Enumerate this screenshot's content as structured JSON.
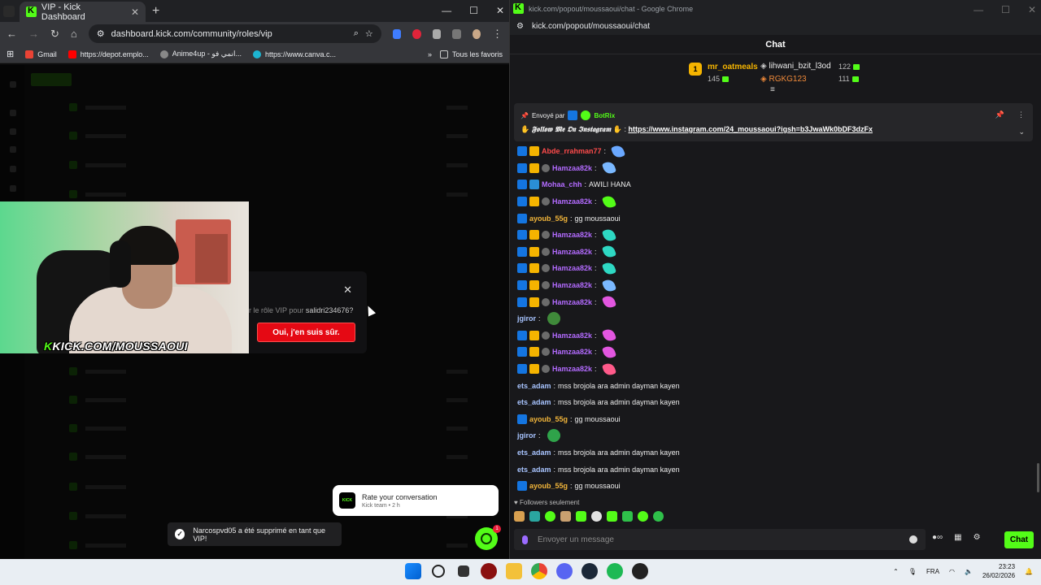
{
  "left_browser": {
    "tab_title": "VIP - Kick Dashboard",
    "url": "dashboard.kick.com/community/roles/vip",
    "bookmarks": [
      "Gmail",
      "https://depot.emplo...",
      "Anime4up - انمي فو...",
      "https://www.canva.c..."
    ],
    "bookmarks_right": "Tous les favoris"
  },
  "webcam": {
    "banner_prefix": "K",
    "banner_text": "KICK.COM/MOUSSAOUI"
  },
  "modal": {
    "prompt": "r le rôle VIP pour ",
    "username": "salidri234676?",
    "confirm_label": "Oui, j'en suis sûr."
  },
  "rate_popup": {
    "title": "Rate your conversation",
    "subtitle": "Kick team • 2 h",
    "logo": "KICK"
  },
  "toast": {
    "text": "Narcospvd05 a été supprimé en tant que VIP!"
  },
  "support": {
    "badge_count": "1"
  },
  "right_browser": {
    "window_title": "kick.com/popout/moussaoui/chat - Google Chrome",
    "url": "kick.com/popout/moussaoui/chat"
  },
  "chat": {
    "header": "Chat",
    "leaderboard": {
      "first": {
        "rank": "1",
        "name": "mr_oatmeals",
        "count": "145"
      },
      "second": {
        "name": "lihwani_bzit_l3od",
        "count": "122"
      },
      "third": {
        "name": "RGKG123",
        "count": "111"
      }
    },
    "pinned": {
      "sent_by": "Envoyé par",
      "author": "BotRix",
      "message_fancy": "𝕱𝖔𝖑𝖑𝖔𝖜 𝕸𝖊 𝕺𝖓 𝕴𝖓𝖘𝖙𝖆𝖌𝖗𝖆𝖒",
      "link": "https://www.instagram.com/24_moussaoui?igsh=b3JwaWk0bDF3dzFx"
    },
    "messages": [
      {
        "user": "Abde_rrahman77",
        "text": "",
        "color": "#ff4b4b",
        "badges": [
          "mod",
          "vip"
        ],
        "emote": "#6aa8ff"
      },
      {
        "user": "Hamzaa82k",
        "text": "",
        "color": "#b36bff",
        "badges": [
          "mod",
          "vip",
          "sub"
        ],
        "emote": "#7ab8ff"
      },
      {
        "user": "Mohaa_chh",
        "text": " AWILI HANA",
        "color": "#b36bff",
        "badges": [
          "mod",
          "vip2"
        ],
        "emote": ""
      },
      {
        "user": "Hamzaa82k",
        "text": "",
        "color": "#b36bff",
        "badges": [
          "mod",
          "vip",
          "sub"
        ],
        "emote": "#53fc18"
      },
      {
        "user": "ayoub_55g",
        "text": " gg moussaoui",
        "color": "#f0b43a",
        "badges": [
          "mod"
        ],
        "emote": ""
      },
      {
        "user": "Hamzaa82k",
        "text": "",
        "color": "#b36bff",
        "badges": [
          "mod",
          "vip",
          "sub"
        ],
        "emote": "#2ed8c3"
      },
      {
        "user": "Hamzaa82k",
        "text": "",
        "color": "#b36bff",
        "badges": [
          "mod",
          "vip",
          "sub"
        ],
        "emote": "#2ed8c3"
      },
      {
        "user": "Hamzaa82k",
        "text": "",
        "color": "#b36bff",
        "badges": [
          "mod",
          "vip",
          "sub"
        ],
        "emote": "#2ed8c3"
      },
      {
        "user": "Hamzaa82k",
        "text": "",
        "color": "#b36bff",
        "badges": [
          "mod",
          "vip",
          "sub"
        ],
        "emote": "#7ab8ff"
      },
      {
        "user": "Hamzaa82k",
        "text": "",
        "color": "#b36bff",
        "badges": [
          "mod",
          "vip",
          "sub"
        ],
        "emote": "#e256e0"
      },
      {
        "user": "jgiror",
        "text": "",
        "color": "#a8c4ff",
        "badges": [],
        "emote": "#3f8a3a"
      },
      {
        "user": "Hamzaa82k",
        "text": "",
        "color": "#b36bff",
        "badges": [
          "mod",
          "vip",
          "sub"
        ],
        "emote": "#e256e0"
      },
      {
        "user": "Hamzaa82k",
        "text": "",
        "color": "#b36bff",
        "badges": [
          "mod",
          "vip",
          "sub"
        ],
        "emote": "#e256e0"
      },
      {
        "user": "Hamzaa82k",
        "text": "",
        "color": "#b36bff",
        "badges": [
          "mod",
          "vip",
          "sub"
        ],
        "emote": "#ff5a8a"
      },
      {
        "user": "ets_adam",
        "text": " mss brojola ara admin dayman kayen",
        "color": "#a8c4ff",
        "badges": [],
        "emote": ""
      },
      {
        "user": "ets_adam",
        "text": " mss brojola ara admin dayman kayen",
        "color": "#a8c4ff",
        "badges": [],
        "emote": ""
      },
      {
        "user": "ayoub_55g",
        "text": " gg moussaoui",
        "color": "#f0b43a",
        "badges": [
          "mod"
        ],
        "emote": ""
      },
      {
        "user": "jgiror",
        "text": "",
        "color": "#a8c4ff",
        "badges": [],
        "emote": "#2fa34a"
      },
      {
        "user": "ets_adam",
        "text": " mss brojola ara admin dayman kayen",
        "color": "#a8c4ff",
        "badges": [],
        "emote": ""
      },
      {
        "user": "ets_adam",
        "text": " mss brojola ara admin dayman kayen",
        "color": "#a8c4ff",
        "badges": [],
        "emote": ""
      },
      {
        "user": "ayoub_55g",
        "text": " gg moussaoui",
        "color": "#f0b43a",
        "badges": [
          "mod"
        ],
        "emote": ""
      }
    ],
    "followers_only": "Followers seulement",
    "input_placeholder": "Envoyer un message",
    "send_label": "Chat"
  },
  "taskbar": {
    "language": "FRA",
    "time": "23:23",
    "date": "26/02/2026"
  },
  "colors": {
    "kick_green": "#53fc18",
    "vip_red": "#e50914"
  }
}
